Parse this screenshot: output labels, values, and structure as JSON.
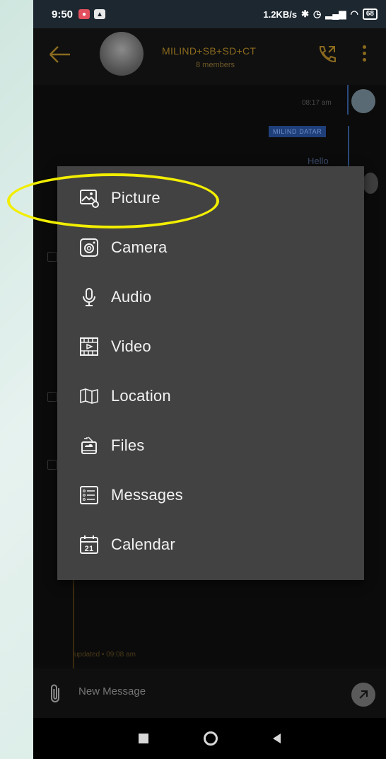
{
  "status_bar": {
    "time": "9:50",
    "network_speed": "1.2KB/s",
    "battery_level": "68",
    "notification_icons": [
      "shield-icon",
      "upload-icon"
    ]
  },
  "chat_header": {
    "title": "MILIND+SB+SD+CT",
    "subtitle": "8 members"
  },
  "chat": {
    "time_1": "08:17 am",
    "sender_name": "MILIND DATAR",
    "message_text": "Hello",
    "updated_text": "updated • 09:08 am"
  },
  "attach_menu": {
    "items": [
      {
        "label": "Picture",
        "icon": "picture-icon"
      },
      {
        "label": "Camera",
        "icon": "camera-icon"
      },
      {
        "label": "Audio",
        "icon": "microphone-icon"
      },
      {
        "label": "Video",
        "icon": "video-icon"
      },
      {
        "label": "Location",
        "icon": "map-icon"
      },
      {
        "label": "Files",
        "icon": "files-icon"
      },
      {
        "label": "Messages",
        "icon": "messages-icon"
      },
      {
        "label": "Calendar",
        "icon": "calendar-icon"
      }
    ],
    "calendar_day": "21"
  },
  "message_bar": {
    "placeholder": "New Message"
  },
  "colors": {
    "accent": "#8a6a1e",
    "menu_background": "#424242",
    "highlight": "#f2ee00"
  }
}
